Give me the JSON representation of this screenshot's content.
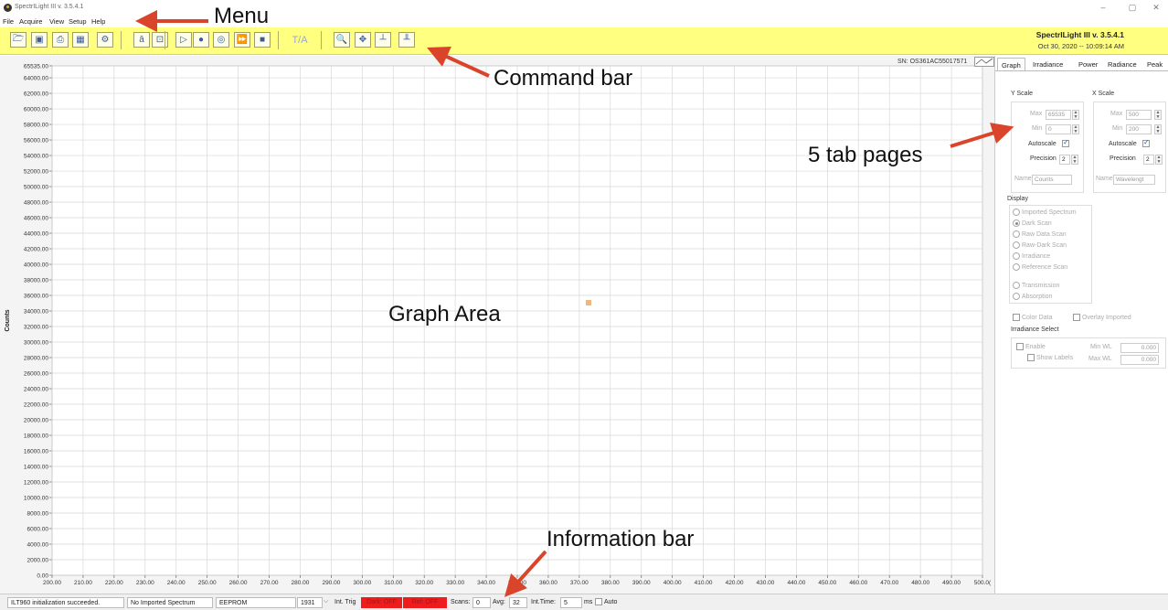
{
  "window": {
    "title": "SpectrILight III v. 3.5.4.1",
    "min_glyph": "–",
    "max_glyph": "▢",
    "close_glyph": "✕"
  },
  "menu": [
    "File",
    "Acquire",
    "View",
    "Setup",
    "Help"
  ],
  "command_bar": {
    "buttons": [
      {
        "icon": "open-folder-icon",
        "glyph": "🗁"
      },
      {
        "icon": "save-icon",
        "glyph": "▣"
      },
      {
        "icon": "print-icon",
        "glyph": "⎙"
      },
      {
        "icon": "table-icon",
        "glyph": "▦"
      },
      {
        "icon": "settings-gear-icon",
        "glyph": "⚙"
      },
      {
        "icon": "text-a-icon",
        "glyph": "ā"
      },
      {
        "icon": "scan-frame-icon",
        "glyph": "⊡"
      },
      {
        "icon": "play-icon",
        "glyph": "▷"
      },
      {
        "icon": "record-icon",
        "glyph": "●"
      },
      {
        "icon": "single-scan-icon",
        "glyph": "◎"
      },
      {
        "icon": "fast-forward-icon",
        "glyph": "⏩"
      },
      {
        "icon": "stop-icon",
        "glyph": "■"
      },
      {
        "icon": "ta-text",
        "glyph": "T/A"
      },
      {
        "icon": "zoom-icon",
        "glyph": "🔍"
      },
      {
        "icon": "pan-move-icon",
        "glyph": "✥"
      },
      {
        "icon": "chart-axis-icon",
        "glyph": "┴"
      },
      {
        "icon": "chart-reset-icon",
        "glyph": "╨"
      }
    ],
    "version_title": "SpectrILight III v. 3.5.4.1",
    "version_date": "Oct 30, 2020 -- 10:09:14 AM"
  },
  "graph": {
    "serial": "SN: OS361AC55017571",
    "y_axis_label": "Counts",
    "center_text": "Graph Area",
    "y_ticks": [
      "65535.00",
      "64000.00",
      "62000.00",
      "60000.00",
      "58000.00",
      "56000.00",
      "54000.00",
      "52000.00",
      "50000.00",
      "48000.00",
      "46000.00",
      "44000.00",
      "42000.00",
      "40000.00",
      "38000.00",
      "36000.00",
      "34000.00",
      "32000.00",
      "30000.00",
      "28000.00",
      "26000.00",
      "24000.00",
      "22000.00",
      "20000.00",
      "18000.00",
      "16000.00",
      "14000.00",
      "12000.00",
      "10000.00",
      "8000.00",
      "6000.00",
      "4000.00",
      "2000.00",
      "0.00"
    ],
    "x_ticks": [
      "200.00",
      "210.00",
      "220.00",
      "230.00",
      "240.00",
      "250.00",
      "260.00",
      "270.00",
      "280.00",
      "290.00",
      "300.00",
      "310.00",
      "320.00",
      "330.00",
      "340.00",
      "350.00",
      "360.00",
      "370.00",
      "380.00",
      "390.00",
      "400.00",
      "410.00",
      "420.00",
      "430.00",
      "440.00",
      "450.00",
      "460.00",
      "470.00",
      "480.00",
      "490.00",
      "500.0("
    ],
    "ylim": [
      0,
      65535
    ],
    "xlim": [
      200,
      500
    ],
    "grid": true,
    "marker_color": "#f0b878"
  },
  "tabs": [
    "Graph",
    "Irradiance",
    "Power",
    "Radiance",
    "Peak"
  ],
  "graph_tab": {
    "y_scale_title": "Y Scale",
    "x_scale_title": "X Scale",
    "y": {
      "max_label": "Max",
      "max_value": "65535",
      "min_label": "Min",
      "min_value": "0",
      "autoscale_label": "Autoscale",
      "precision_label": "Precision",
      "precision_value": "2",
      "name_label": "Name",
      "name_value": "Counts"
    },
    "x": {
      "max_label": "Max",
      "max_value": "500",
      "min_label": "Min",
      "min_value": "200",
      "autoscale_label": "Autoscale",
      "precision_label": "Precision",
      "precision_value": "2",
      "name_label": "Name",
      "name_value": "Wavelengt"
    },
    "display_title": "Display",
    "display_options": [
      "Imported Spectrum",
      "Dark Scan",
      "Raw Data Scan",
      "Raw-Dark Scan",
      "Irradiance",
      "Reference Scan"
    ],
    "display_options_2": [
      "Transmission",
      "Absorption"
    ],
    "color_data_label": "Color Data",
    "overlay_label": "Overlay Imported",
    "irradiance_title": "Irradiance Select",
    "enable_label": "Enable",
    "show_labels_label": "Show Labels",
    "min_wl_label": "Min WL",
    "min_wl_value": "0.000",
    "max_wl_label": "Max WL",
    "max_wl_value": "0.000"
  },
  "info_bar": {
    "status": "ILT960 initialization succeeded.",
    "imported": "No Imported Spectrum",
    "eeprom": "EEPROM",
    "trigger_value": "1931",
    "int_trig": "Int. Trig",
    "dark": "Dark: OFF",
    "ref": "Ref: OFF",
    "scans_label": "Scans:",
    "scans_value": "0",
    "avg_label": "Avg:",
    "avg_value": "32",
    "int_time_label": "Int.Time:",
    "int_time_value": "5",
    "ms_label": "ms",
    "auto_label": "Auto"
  },
  "annotations": {
    "menu": "Menu",
    "command_bar": "Command bar",
    "tab_pages": "5 tab pages",
    "info_bar": "Information bar",
    "arrow_color": "#d9442a"
  }
}
